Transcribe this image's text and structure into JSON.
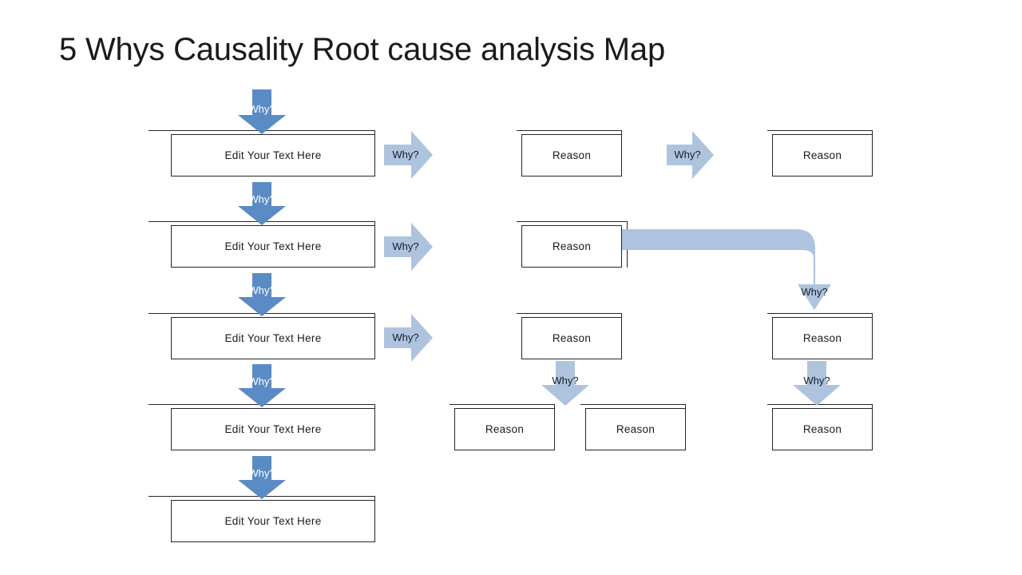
{
  "slide": {
    "title": "5 Whys Causality Root cause analysis Map",
    "background": "#ffffff"
  },
  "colors": {
    "arrow_dark_blue": "#5b8bc4",
    "arrow_light_blue": "#aec3dd",
    "box_border": "#26262b",
    "box_fill": "#ffffff",
    "title_text": "#1a1a1a",
    "label_text": "#1b1b1b",
    "arrow_light_text": "#ffffff",
    "arrow_dark_text": "#15202b"
  },
  "labels": {
    "edit_text": "Edit Your Text Here",
    "reason": "Reason",
    "why": "Why?"
  },
  "column_left": {
    "name": "problem-chain",
    "boxes": [
      {
        "id": "left-box-1",
        "label": "Edit Your Text Here"
      },
      {
        "id": "left-box-2",
        "label": "Edit Your Text Here"
      },
      {
        "id": "left-box-3",
        "label": "Edit Your Text Here"
      },
      {
        "id": "left-box-4",
        "label": "Edit Your Text Here"
      },
      {
        "id": "left-box-5",
        "label": "Edit Your Text Here"
      }
    ],
    "down_arrows": [
      {
        "id": "left-down-0",
        "label": "Why?",
        "style": "dark"
      },
      {
        "id": "left-down-1",
        "label": "Why?",
        "style": "dark"
      },
      {
        "id": "left-down-2",
        "label": "Why?",
        "style": "dark"
      },
      {
        "id": "left-down-3",
        "label": "Why?",
        "style": "dark"
      },
      {
        "id": "left-down-4",
        "label": "Why?",
        "style": "dark"
      }
    ],
    "right_arrows": [
      {
        "id": "left-right-1",
        "label": "Why?",
        "style": "light"
      },
      {
        "id": "left-right-2",
        "label": "Why?",
        "style": "light"
      },
      {
        "id": "left-right-3",
        "label": "Why?",
        "style": "light"
      }
    ]
  },
  "column_middle": {
    "name": "reason-column-middle",
    "boxes": [
      {
        "id": "mid-box-1",
        "label": "Reason"
      },
      {
        "id": "mid-box-2",
        "label": "Reason"
      },
      {
        "id": "mid-box-3",
        "label": "Reason"
      },
      {
        "id": "mid-box-4a",
        "label": "Reason"
      },
      {
        "id": "mid-box-4b",
        "label": "Reason"
      }
    ],
    "arrows": [
      {
        "id": "mid-right-1",
        "label": "Why?",
        "style": "light",
        "direction": "right"
      },
      {
        "id": "mid-down-3",
        "label": "Why?",
        "style": "light",
        "direction": "down"
      }
    ]
  },
  "column_right": {
    "name": "reason-column-right",
    "boxes": [
      {
        "id": "right-box-1",
        "label": "Reason"
      },
      {
        "id": "right-box-3",
        "label": "Reason"
      },
      {
        "id": "right-box-4",
        "label": "Reason"
      }
    ],
    "arrows": [
      {
        "id": "elbow-why",
        "label": "Why?",
        "style": "light",
        "direction": "elbow-down"
      },
      {
        "id": "right-down-3",
        "label": "Why?",
        "style": "light",
        "direction": "down"
      }
    ]
  }
}
